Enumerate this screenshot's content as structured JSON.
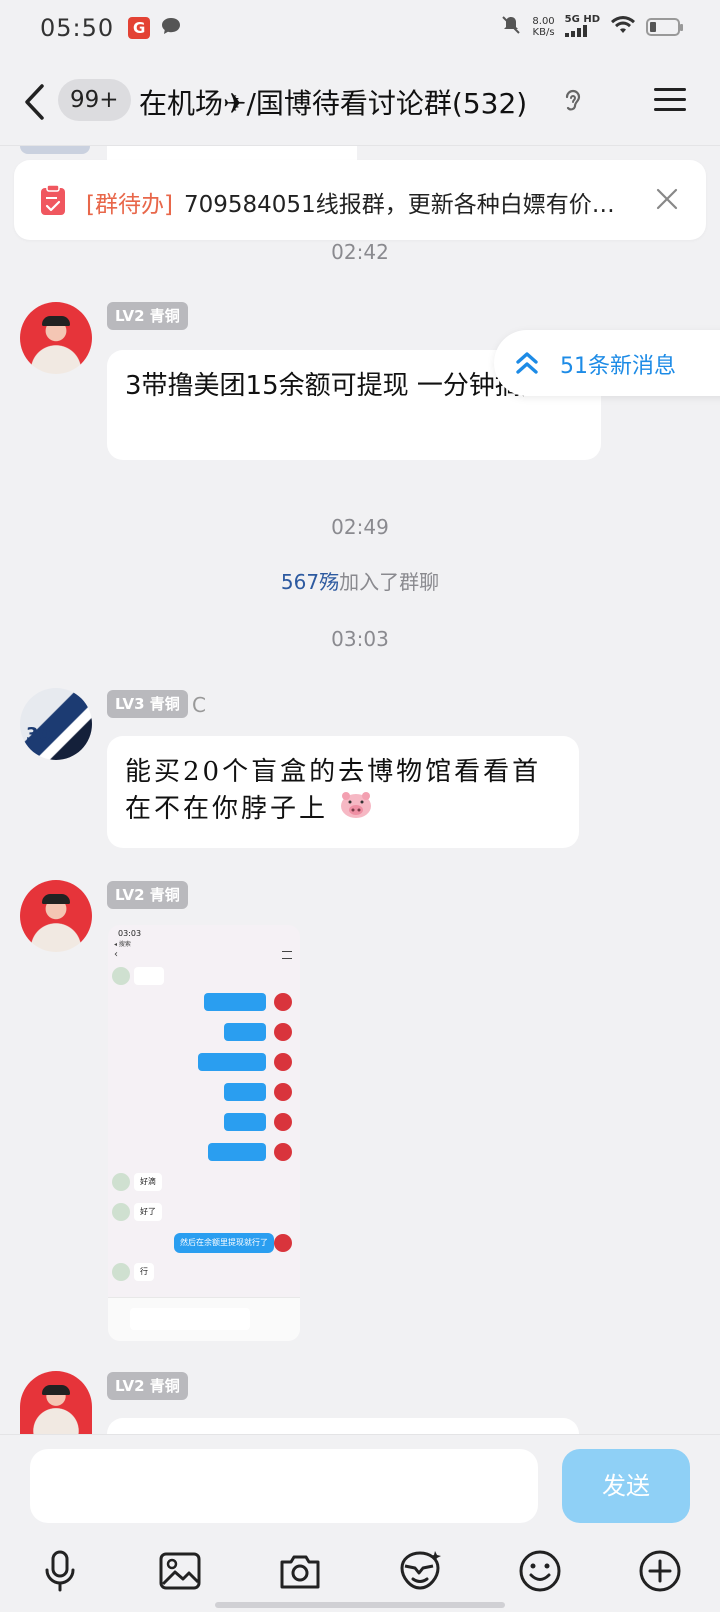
{
  "status_bar": {
    "time": "05:50",
    "app_icon_letter": "G",
    "net_speed_value": "8.00",
    "net_speed_unit": "KB/s",
    "network_type": "5G HD"
  },
  "header": {
    "unread_count": "99+",
    "title": "在机场✈/国博待看讨论群(532)"
  },
  "pinned": {
    "tag": "[群待办]",
    "text": "709584051线报群，更新各种白嫖有价…"
  },
  "new_messages": {
    "label": "51条新消息"
  },
  "messages": [
    {
      "time": "02:42"
    },
    {
      "level": "LV2 青铜",
      "text": "3带撸美团15余额可提现  一分钟搞定"
    },
    {
      "time": "02:49"
    },
    {
      "notice_name": "567殇",
      "notice_text": "加入了群聊"
    },
    {
      "time": "03:03"
    },
    {
      "level": "LV3 青铜",
      "name": "C",
      "text": "能买20个盲盒的去博物馆看看首在不在你脖子上"
    },
    {
      "level": "LV2 青铜",
      "image_time": "03:03",
      "image_back": "◂ 搜索",
      "mini_msgs": [
        "好滴",
        "好了",
        "然后在余额里提现就行了",
        "行"
      ]
    },
    {
      "level": "LV2 青铜"
    }
  ],
  "input": {
    "placeholder": "",
    "send_label": "发送"
  },
  "toolbar": {
    "icons": [
      "microphone-icon",
      "image-icon",
      "camera-icon",
      "red-packet-icon",
      "emoji-icon",
      "plus-icon"
    ]
  }
}
